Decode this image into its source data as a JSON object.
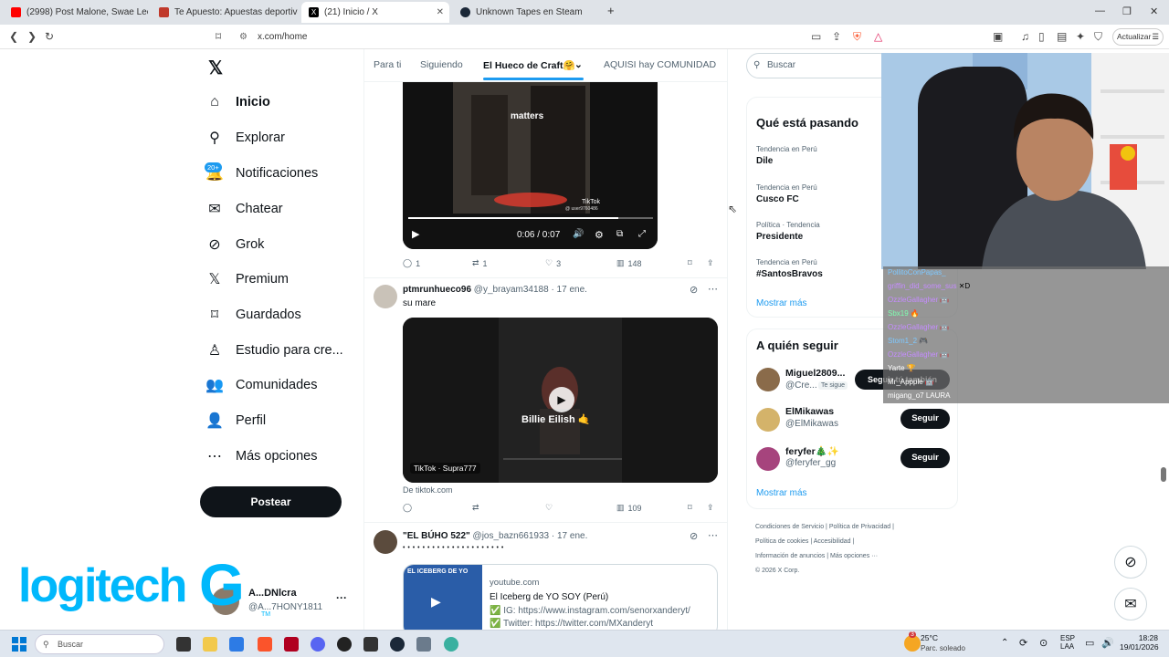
{
  "browser": {
    "tabs": [
      {
        "title": "(2998) Post Malone, Swae Lee - Sunfl",
        "icon": "youtube-icon",
        "color": "#ff0000"
      },
      {
        "title": "Te Apuesto: Apuestas deportivas y C",
        "icon": "teapuesto-icon",
        "color": "#c0392b"
      },
      {
        "title": "(21) Inicio / X",
        "icon": "x-icon",
        "color": "#000000"
      },
      {
        "title": "Unknown Tapes en Steam",
        "icon": "steam-icon",
        "color": "#1b2838"
      }
    ],
    "new_tab": "+",
    "url": "x.com/home",
    "update_label": "Actualizar",
    "brave_count": "3",
    "alert_count": "1"
  },
  "nav": {
    "items": [
      {
        "label": "Inicio",
        "icon": "home-icon",
        "glyph": "⌂"
      },
      {
        "label": "Explorar",
        "icon": "search-icon",
        "glyph": "⚲"
      },
      {
        "label": "Notificaciones",
        "icon": "bell-icon",
        "glyph": "🔔"
      },
      {
        "label": "Chatear",
        "icon": "mail-icon",
        "glyph": "✉"
      },
      {
        "label": "Grok",
        "icon": "grok-icon",
        "glyph": "⊘"
      },
      {
        "label": "Premium",
        "icon": "x-icon",
        "glyph": "𝕏"
      },
      {
        "label": "Guardados",
        "icon": "bookmark-icon",
        "glyph": "⌑"
      },
      {
        "label": "Estudio para cre...",
        "icon": "studio-icon",
        "glyph": "♙"
      },
      {
        "label": "Comunidades",
        "icon": "communities-icon",
        "glyph": "👥"
      },
      {
        "label": "Perfil",
        "icon": "profile-icon",
        "glyph": "👤"
      },
      {
        "label": "Más opciones",
        "icon": "more-icon",
        "glyph": "⋯"
      }
    ],
    "notif_badge": "20+",
    "post_label": "Postear",
    "account_name": "A...DNlcra",
    "account_handle": "@A...7HONY1811",
    "more": "···"
  },
  "timeline": {
    "tabs": [
      "Para ti",
      "Siguiendo",
      "El Hueco de Craft🤗",
      "AQUISI hay COMUNIDAD"
    ],
    "tweet1": {
      "overlay": "matters",
      "tiktok": "TikTok",
      "tiktok_user": "@ user9760486",
      "time": "0:06 / 0:07",
      "replies": "1",
      "retweets": "1",
      "likes": "3",
      "views": "148"
    },
    "tweet2": {
      "name": "ptmrunhueco96",
      "handle": "@y_brayam34188",
      "date": "· 17 ene.",
      "text": "su mare",
      "video_caption": "Billie Eilish 🤙",
      "video_tag": "TikTok · Supra777",
      "source": "De tiktok.com",
      "views": "109"
    },
    "tweet3": {
      "name": "\"EL BÚHO 522\"",
      "handle": "@jos_bazn661933",
      "date": "· 17 ene.",
      "text": "• • • • • • • • • • • • • • • • • • • • •",
      "card_domain": "youtube.com",
      "card_title": "El Iceberg de YO SOY (Perú)",
      "card_line1": "✅ IG: https://www.instagram.com/senorxanderyt/",
      "card_line2": "✅ Twitter: https://twitter.com/MXanderyt",
      "thumb_text": "EL ICEBERG DE YO"
    }
  },
  "right": {
    "search_placeholder": "Buscar",
    "trends_title": "Qué está pasando",
    "trends": [
      {
        "meta": "Tendencia en Perú",
        "name": "Dile"
      },
      {
        "meta": "Tendencia en Perú",
        "name": "Cusco FC"
      },
      {
        "meta": "Política · Tendencia",
        "name": "Presidente"
      },
      {
        "meta": "Tendencia en Perú",
        "name": "#SantosBravos"
      }
    ],
    "show_more": "Mostrar más",
    "follow_title": "A quién seguir",
    "follow": [
      {
        "name": "Miguel2809...",
        "handle": "@Cre...",
        "follows_you": "Te sigue",
        "button": "Seguir tú también"
      },
      {
        "name": "ElMikawas",
        "handle": "@ElMikawas",
        "button": "Seguir"
      },
      {
        "name": "feryfer🎄✨",
        "handle": "@feryfer_gg",
        "button": "Seguir"
      }
    ],
    "footer_links": [
      "Condiciones de Servicio",
      "Política de Privacidad",
      "Política de cookies",
      "Accesibilidad",
      "Información de anuncios",
      "Más opciones ···"
    ],
    "copyright": "© 2026 X Corp."
  },
  "overlay": {
    "chat": [
      {
        "user": "PollitoConPapas_",
        "color": "#7ec8ff"
      },
      {
        "user": "griffin_did_some_sus",
        "color": "#c58cff",
        "msg": "✕D"
      },
      {
        "user": "OzzleGallagher",
        "color": "#c58cff",
        "msg": "🤖"
      },
      {
        "user": "Sbx19",
        "color": "#7fffb0",
        "msg": "🔥"
      },
      {
        "user": "OzzleGallagher",
        "color": "#c58cff",
        "msg": "🤖"
      },
      {
        "user": "Stom1_2",
        "color": "#7ec8ff",
        "msg": "🎮"
      },
      {
        "user": "OzzleGallagher",
        "color": "#c58cff",
        "msg": "🤖"
      },
      {
        "user": "Yarte",
        "color": "#ffffff",
        "msg": "🏆"
      },
      {
        "user": "Mr_Appple",
        "color": "#ffffff",
        "msg": "🤖"
      },
      {
        "user": "migang_o7",
        "color": "#ffffff",
        "msg": "LAURA"
      }
    ],
    "logo_text": "logitech",
    "logo_g": "G",
    "logo_tm": "TM"
  },
  "taskbar": {
    "search_placeholder": "Buscar",
    "weather_temp": "25°C",
    "weather_desc": "Parc. soleado",
    "weather_badge": "3",
    "lang1": "ESP",
    "lang2": "LAA",
    "time": "18:28",
    "date": "19/01/2026"
  }
}
